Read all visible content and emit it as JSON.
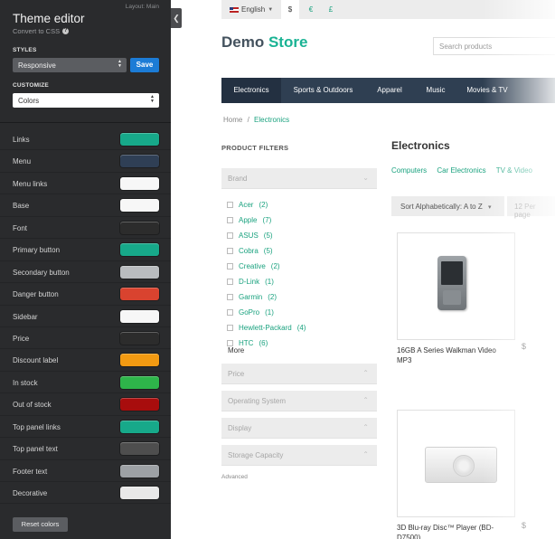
{
  "editor": {
    "layout_link": "Layout: Main",
    "title": "Theme editor",
    "subtitle": "Convert to CSS",
    "styles_label": "STYLES",
    "style_value": "Responsive",
    "save_label": "Save",
    "customize_label": "CUSTOMIZE",
    "customize_value": "Colors",
    "colors": [
      {
        "label": "Links",
        "color": "#17a98a"
      },
      {
        "label": "Menu",
        "color": "#2f3f55"
      },
      {
        "label": "Menu links",
        "color": "#f7f7f7"
      },
      {
        "label": "Base",
        "color": "#f7f7f7"
      },
      {
        "label": "Font",
        "color": "#2c2c2c"
      },
      {
        "label": "Primary button",
        "color": "#17a98a"
      },
      {
        "label": "Secondary button",
        "color": "#b9bcbf"
      },
      {
        "label": "Danger button",
        "color": "#d9432f"
      },
      {
        "label": "Sidebar",
        "color": "#f7f7f7"
      },
      {
        "label": "Price",
        "color": "#2c2c2c"
      },
      {
        "label": "Discount label",
        "color": "#f29a12"
      },
      {
        "label": "In stock",
        "color": "#2eb54a"
      },
      {
        "label": "Out of stock",
        "color": "#a80d0d"
      },
      {
        "label": "Top panel links",
        "color": "#17a98a"
      },
      {
        "label": "Top panel text",
        "color": "#4e4e4e"
      },
      {
        "label": "Footer text",
        "color": "#9da1a5"
      },
      {
        "label": "Decorative",
        "color": "#e8e8e8"
      }
    ],
    "reset_label": "Reset colors",
    "collapse_glyph": "❮"
  },
  "store": {
    "language": "English",
    "currencies": [
      "$",
      "€",
      "£"
    ],
    "logo_part1": "Demo",
    "logo_part2": "Store",
    "search_placeholder": "Search products",
    "nav": [
      "Electronics",
      "Sports & Outdoors",
      "Apparel",
      "Music",
      "Movies & TV"
    ],
    "breadcrumb_home": "Home",
    "breadcrumb_sep": "/",
    "breadcrumb_current": "Electronics",
    "filters_heading": "PRODUCT FILTERS",
    "brand_facet": "Brand",
    "brands": [
      {
        "name": "Acer",
        "count": "(2)"
      },
      {
        "name": "Apple",
        "count": "(7)"
      },
      {
        "name": "ASUS",
        "count": "(5)"
      },
      {
        "name": "Cobra",
        "count": "(5)"
      },
      {
        "name": "Creative",
        "count": "(2)"
      },
      {
        "name": "D-Link",
        "count": "(1)"
      },
      {
        "name": "Garmin",
        "count": "(2)"
      },
      {
        "name": "GoPro",
        "count": "(1)"
      },
      {
        "name": "Hewlett-Packard",
        "count": "(4)"
      },
      {
        "name": "HTC",
        "count": "(6)"
      }
    ],
    "more_label": "More",
    "facets": [
      "Price",
      "Operating System",
      "Display",
      "Storage Capacity"
    ],
    "advanced_label": "Advanced",
    "category_title": "Electronics",
    "subcategories": [
      "Computers",
      "Car Electronics",
      "TV & Video"
    ],
    "sort_label": "Sort Alphabetically: A to Z",
    "per_page_label": "12 Per page",
    "products": [
      {
        "name": "16GB A Series Walkman Video MP3"
      },
      {
        "name": "3D Blu-ray Disc™ Player (BD-D7500)"
      }
    ],
    "products_col2": [
      "$",
      "$"
    ]
  }
}
